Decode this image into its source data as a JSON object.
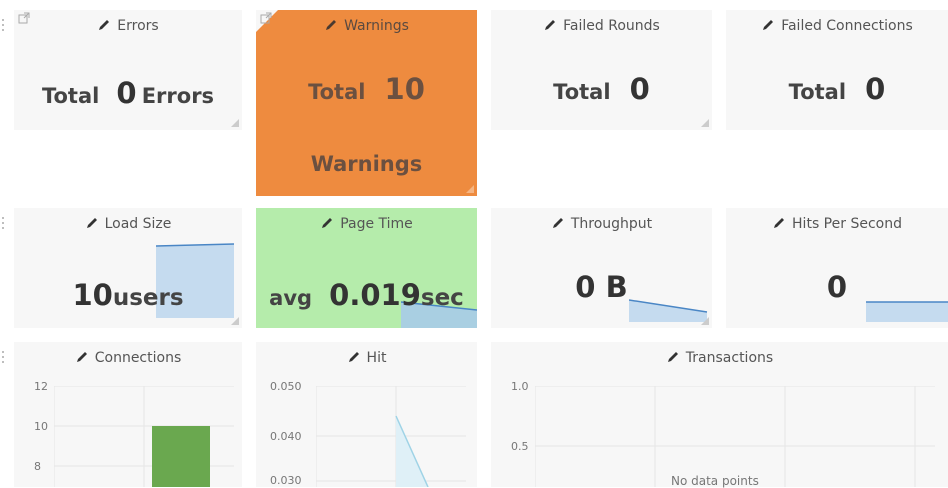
{
  "tiles": {
    "errors": {
      "title": "Errors",
      "prefix": "Total",
      "value": "0",
      "suffix": "Errors"
    },
    "warnings": {
      "title": "Warnings",
      "prefix": "Total",
      "value": "10",
      "suffix": "Warnings"
    },
    "failed_rounds": {
      "title": "Failed Rounds",
      "prefix": "Total",
      "value": "0"
    },
    "failed_connections": {
      "title": "Failed Connections",
      "prefix": "Total",
      "value": "0"
    },
    "load_size": {
      "title": "Load Size",
      "value": "10",
      "unit": "users"
    },
    "page_time": {
      "title": "Page Time",
      "prefix": "avg",
      "value": "0.019",
      "unit": "sec"
    },
    "throughput": {
      "title": "Throughput",
      "value": "0 B"
    },
    "hits_per_second": {
      "title": "Hits Per Second",
      "value": "0"
    }
  },
  "charts": {
    "connections": {
      "title": "Connections",
      "chart_data": {
        "type": "bar",
        "y_ticks": [
          "12",
          "10",
          "8"
        ],
        "values": [
          10
        ],
        "ylim": [
          8,
          12
        ],
        "color": "#6aa84f"
      }
    },
    "hit": {
      "title": "Hit",
      "chart_data": {
        "type": "area",
        "y_ticks": [
          "0.050",
          "0.040",
          "0.030"
        ],
        "ylim": [
          0.03,
          0.05
        ],
        "color": "#9fd3e6"
      }
    },
    "transactions": {
      "title": "Transactions",
      "no_data": "No data points",
      "chart_data": {
        "type": "line",
        "y_ticks": [
          "1.0",
          "0.5"
        ],
        "ylim": [
          0,
          1
        ]
      }
    }
  },
  "colors": {
    "warning_bg": "#ee8b3f",
    "ok_bg": "#b5ecab",
    "spark_fill": "#c5dbef",
    "spark_line": "#4a86c5"
  }
}
